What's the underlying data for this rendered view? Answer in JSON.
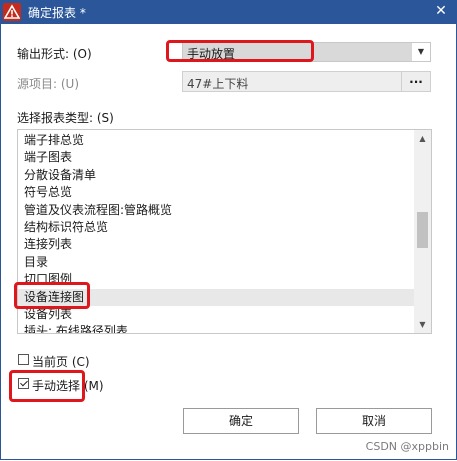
{
  "window": {
    "title": "确定报表 *",
    "close_glyph": "✕"
  },
  "form": {
    "output_form_label": "输出形式: (O)",
    "output_form_value": "手动放置",
    "source_label": "源项目: (U)",
    "source_value": "47#上下料",
    "source_browse": "..."
  },
  "report_types": {
    "label": "选择报表类型: (S)",
    "items": [
      "端子排总览",
      "端子图表",
      "分散设备清单",
      "符号总览",
      "管道及仪表流程图:管路概览",
      "结构标识符总览",
      "连接列表",
      "目录",
      "切口图例",
      "设备连接图",
      "设备列表",
      "插头: 布线路径列表"
    ],
    "selected_index": 9
  },
  "options": {
    "current_page_label": "当前页 (C)",
    "current_page_checked": false,
    "manual_select_label": "手动选择 (M)",
    "manual_select_checked": true
  },
  "buttons": {
    "ok": "确定",
    "cancel": "取消"
  },
  "watermark": "CSDN @xppbin",
  "colors": {
    "titlebar": "#2b579a",
    "highlight": "#e0161d",
    "warning_icon": "#c42b1c"
  },
  "icons": {
    "title_icon": "warning-triangle-icon"
  }
}
